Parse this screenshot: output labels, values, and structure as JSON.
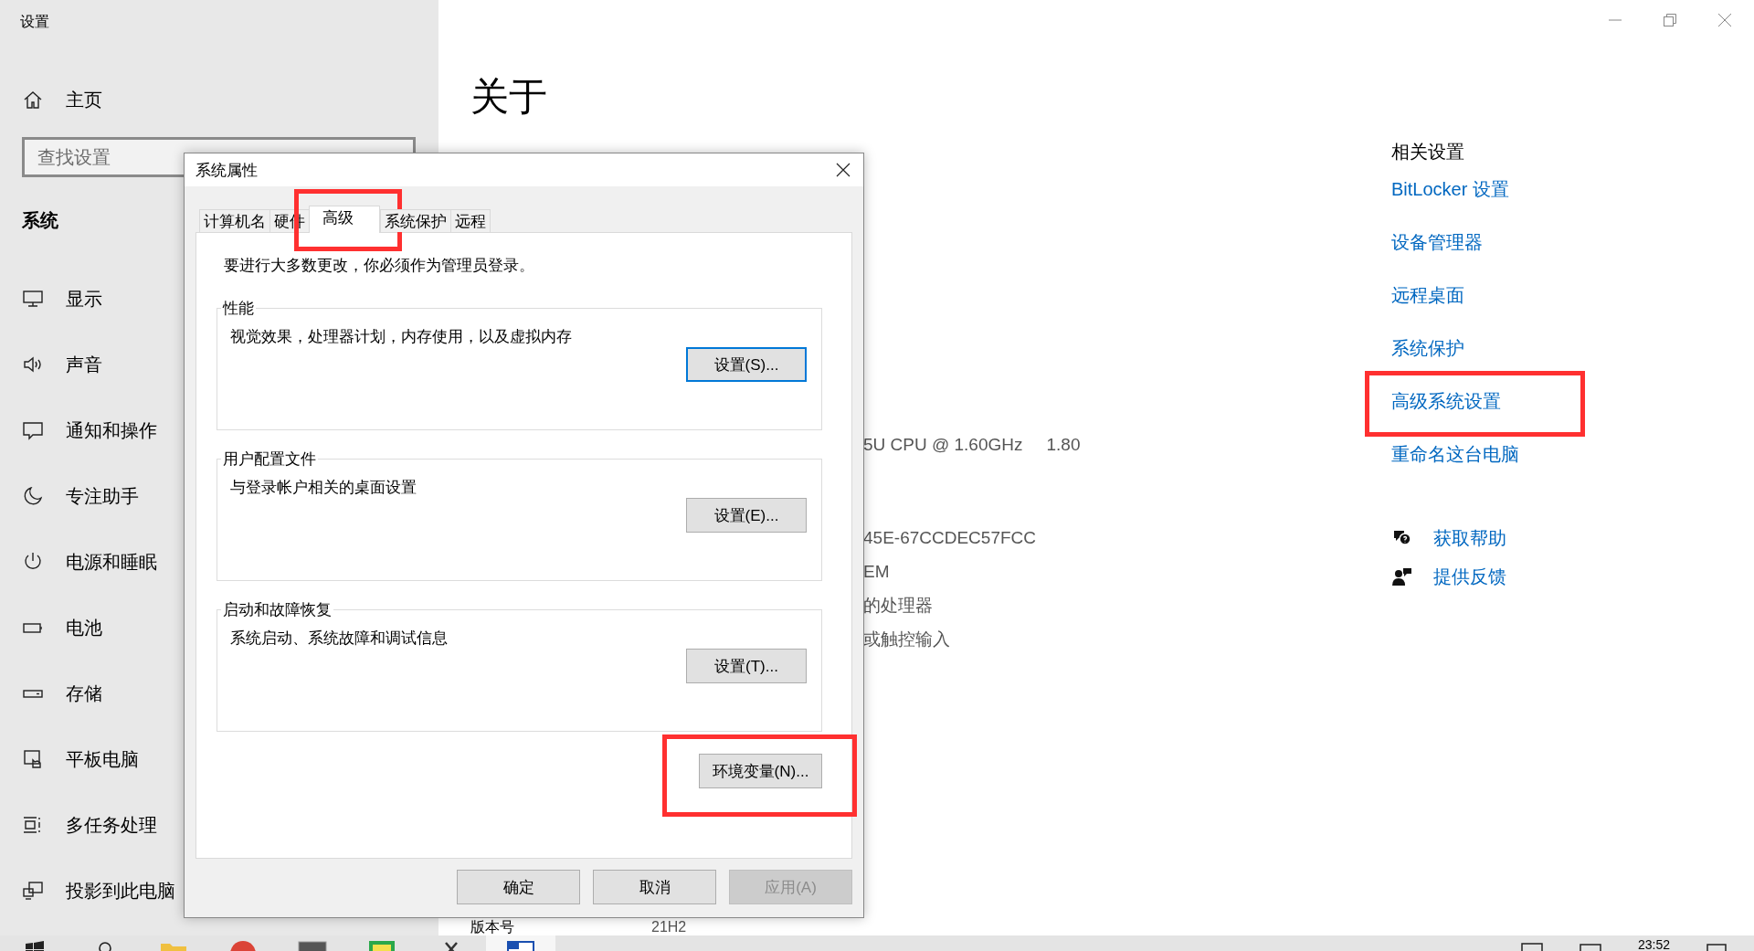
{
  "settings_window": {
    "title": "设置"
  },
  "sidebar": {
    "home": "主页",
    "search": {
      "placeholder": "查找设置"
    },
    "section": "系统",
    "items": [
      {
        "label": "显示"
      },
      {
        "label": "声音"
      },
      {
        "label": "通知和操作"
      },
      {
        "label": "专注助手"
      },
      {
        "label": "电源和睡眠"
      },
      {
        "label": "电池"
      },
      {
        "label": "存储"
      },
      {
        "label": "平板电脑"
      },
      {
        "label": "多任务处理"
      },
      {
        "label": "投影到此电脑"
      }
    ]
  },
  "page": {
    "title": "关于",
    "spec_fragments": [
      {
        "text": "5U CPU @ 1.60GHz",
        "extra": "1.80"
      },
      {
        "text": "45E-67CCDEC57FCC"
      },
      {
        "text": "EM"
      },
      {
        "text": "的处理器"
      },
      {
        "text": "或触控输入"
      }
    ],
    "version": {
      "label": "版本号",
      "value": "21H2"
    }
  },
  "related": {
    "heading": "相关设置",
    "links": [
      {
        "label": "BitLocker 设置",
        "highlighted": false
      },
      {
        "label": "设备管理器",
        "highlighted": false
      },
      {
        "label": "远程桌面",
        "highlighted": false
      },
      {
        "label": "系统保护",
        "highlighted": false
      },
      {
        "label": "高级系统设置",
        "highlighted": true
      },
      {
        "label": "重命名这台电脑",
        "highlighted": false
      }
    ],
    "help_links": [
      {
        "label": "获取帮助"
      },
      {
        "label": "提供反馈"
      }
    ]
  },
  "dialog": {
    "title": "系统属性",
    "tabs": [
      {
        "label": "计算机名",
        "selected": false,
        "highlighted": false
      },
      {
        "label": "硬件",
        "selected": false,
        "highlighted": false
      },
      {
        "label": "高级",
        "selected": true,
        "highlighted": true
      },
      {
        "label": "系统保护",
        "selected": false,
        "highlighted": false
      },
      {
        "label": "远程",
        "selected": false,
        "highlighted": false
      }
    ],
    "notice": "要进行大多数更改，你必须作为管理员登录。",
    "groups": [
      {
        "title": "性能",
        "description": "视觉效果，处理器计划，内存使用，以及虚拟内存",
        "button": {
          "label": "设置(S)...",
          "focused": true
        }
      },
      {
        "title": "用户配置文件",
        "description": "与登录帐户相关的桌面设置",
        "button": {
          "label": "设置(E)...",
          "focused": false
        }
      },
      {
        "title": "启动和故障恢复",
        "description": "系统启动、系统故障和调试信息",
        "button": {
          "label": "设置(T)...",
          "focused": false
        }
      }
    ],
    "env_button": {
      "label": "环境变量(N)...",
      "highlighted": true
    },
    "buttons": [
      {
        "label": "确定",
        "disabled": false
      },
      {
        "label": "取消",
        "disabled": false
      },
      {
        "label": "应用(A)",
        "disabled": true
      }
    ]
  },
  "taskbar": {
    "clock": "23:52"
  }
}
